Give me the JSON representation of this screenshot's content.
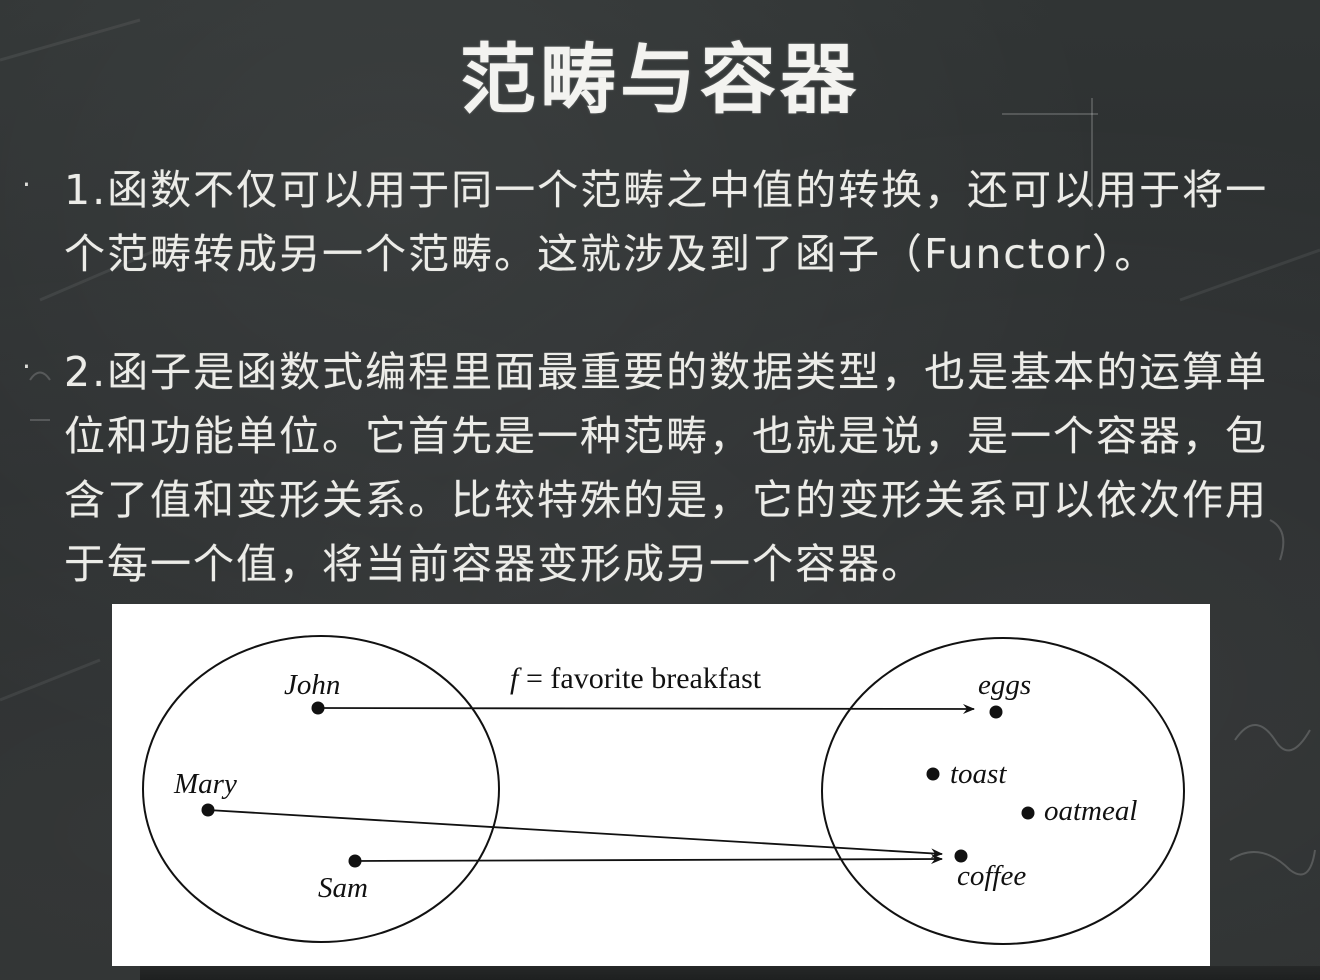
{
  "slide": {
    "title": "范畴与容器",
    "bullets": [
      {
        "marker": "·",
        "text": "1.函数不仅可以用于同一个范畴之中值的转换，还可以用于将一个范畴转成另一个范畴。这就涉及到了函子（Functor）。"
      },
      {
        "marker": "·",
        "text": "2.函子是函数式编程里面最重要的数据类型，也是基本的运算单位和功能单位。它首先是一种范畴，也就是说，是一个容器，包含了值和变形关系。比较特殊的是，它的变形关系可以依次作用于每一个值，将当前容器变形成另一个容器。"
      }
    ]
  },
  "diagram": {
    "function_label_f": "f",
    "function_label_rest": "= favorite breakfast",
    "domain": [
      "John",
      "Mary",
      "Sam"
    ],
    "codomain": [
      "eggs",
      "toast",
      "oatmeal",
      "coffee"
    ],
    "mappings": [
      {
        "from": "John",
        "to": "eggs"
      },
      {
        "from": "Mary",
        "to": "coffee"
      },
      {
        "from": "Sam",
        "to": "coffee"
      }
    ]
  },
  "colors": {
    "chalkboard": "#2c2f30",
    "chalk_text": "#ecece8",
    "figure_bg": "#ffffff",
    "figure_ink": "#111111"
  }
}
